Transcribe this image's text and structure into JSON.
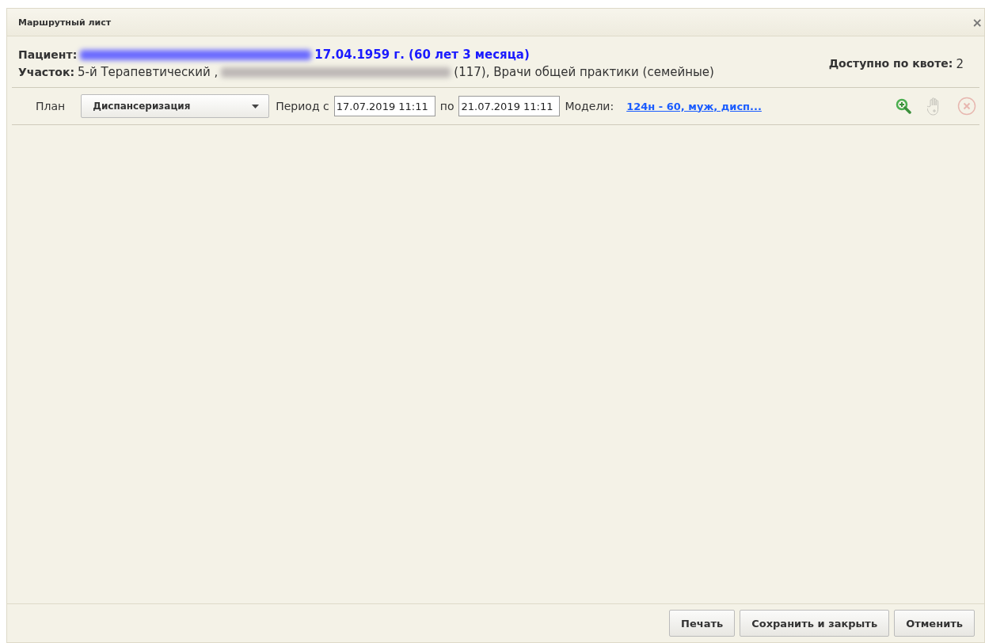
{
  "window": {
    "title": "Маршрутный лист",
    "close": "×"
  },
  "patient": {
    "label": "Пациент:",
    "birth": "17.04.1959 г. (60 лет 3 месяца)"
  },
  "district": {
    "label": "Участок:",
    "name": "5-й Терапевтический ,",
    "rest": "(117), Врачи общей практики (семейные)"
  },
  "quota": {
    "label": "Доступно по квоте:",
    "value": "2"
  },
  "toolbar": {
    "plan_label": "План",
    "plan_value": "Диспансеризация",
    "period_label": "Период с",
    "date_from": "17.07.2019 11:11",
    "to_label": "по",
    "date_to": "21.07.2019 11:11",
    "models_label": "Модели:",
    "models_link": "124н - 60, муж, дисп...",
    "icons": [
      {
        "kind": "zoom",
        "disabled": false
      },
      {
        "kind": "hand",
        "disabled": true
      },
      {
        "kind": "cancel",
        "disabled": true
      }
    ]
  },
  "buttons": [
    "Печать",
    "Сохранить и закрыть",
    "Отменить"
  ]
}
